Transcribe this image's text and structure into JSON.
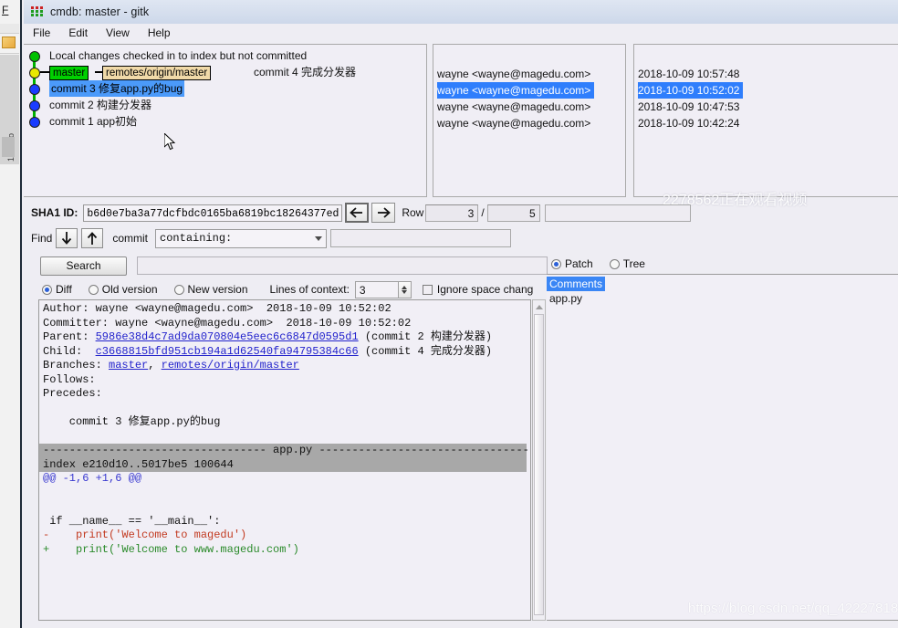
{
  "background_window": {
    "menu_fragment": "F",
    "side_label": "1. Perio"
  },
  "window": {
    "title": "cmdb: master - gitk",
    "icon": "gitk-dots-icon",
    "menus": [
      {
        "label": "File"
      },
      {
        "label": "Edit"
      },
      {
        "label": "View"
      },
      {
        "label": "Help"
      }
    ]
  },
  "commit_graph": {
    "rows": [
      {
        "node_color": "green",
        "text": "Local changes checked in to index but not committed",
        "selected": false,
        "refs": []
      },
      {
        "node_color": "yellow",
        "text": "commit 4 完成分发器",
        "selected": false,
        "refs": [
          {
            "label": "master",
            "type": "local"
          },
          {
            "label": "remotes/origin/master",
            "type": "remote"
          }
        ]
      },
      {
        "node_color": "blue",
        "text": "commit 3 修复app.py的bug",
        "selected": true,
        "refs": []
      },
      {
        "node_color": "blue",
        "text": "commit 2 构建分发器",
        "selected": false,
        "refs": []
      },
      {
        "node_color": "blue",
        "text": "commit 1 app初始",
        "selected": false,
        "refs": []
      }
    ],
    "authors": [
      {
        "value": "wayne <wayne@magedu.com>",
        "selected": false
      },
      {
        "value": "wayne <wayne@magedu.com>",
        "selected": true
      },
      {
        "value": "wayne <wayne@magedu.com>",
        "selected": false
      },
      {
        "value": "wayne <wayne@magedu.com>",
        "selected": false
      }
    ],
    "dates": [
      {
        "value": "2018-10-09 10:57:48",
        "selected": false
      },
      {
        "value": "2018-10-09 10:52:02",
        "selected": true
      },
      {
        "value": "2018-10-09 10:47:53",
        "selected": false
      },
      {
        "value": "2018-10-09 10:42:24",
        "selected": false
      }
    ]
  },
  "sha_row": {
    "label": "SHA1 ID:",
    "value": "b6d0e7ba3a77dcfbdc0165ba6819bc18264377ed",
    "back_icon": "arrow-left-icon",
    "forward_icon": "arrow-right-icon",
    "row_label": "Row",
    "row_current": "3",
    "separator": "/",
    "row_total": "5"
  },
  "find_row": {
    "label": "Find",
    "down_icon": "arrow-down-icon",
    "up_icon": "arrow-up-icon",
    "scope_label": "commit",
    "criteria": "containing:",
    "criteria_caret": "chevron-down-icon",
    "query": ""
  },
  "search_row": {
    "button_label": "Search",
    "query": ""
  },
  "diff_options": {
    "modes": [
      {
        "label": "Diff",
        "selected": true
      },
      {
        "label": "Old version",
        "selected": false
      },
      {
        "label": "New version",
        "selected": false
      }
    ],
    "context_label": "Lines of context:",
    "context_value": "3",
    "ignore_space_label": "Ignore space chang",
    "ignore_space_checked": false
  },
  "diff_panel": {
    "header_lines": [
      {
        "prefix": "Author: ",
        "text": "wayne <wayne@magedu.com>  2018-10-09 10:52:02"
      },
      {
        "prefix": "Committer: ",
        "text": "wayne <wayne@magedu.com>  2018-10-09 10:52:02"
      }
    ],
    "parent_label": "Parent: ",
    "parent_sha": "5986e38d4c7ad9da070804e5eec6c6847d0595d1",
    "parent_suffix": " (commit 2 构建分发器)",
    "child_label": "Child:  ",
    "child_sha": "c3668815bfd951cb194a1d62540fa94795384c66",
    "child_suffix": " (commit 4 完成分发器)",
    "branches_label": "Branches: ",
    "branches": [
      "master",
      "remotes/origin/master"
    ],
    "branches_separator": ", ",
    "follows_label": "Follows:",
    "precedes_label": "Precedes:",
    "commit_message": "    commit 3 修复app.py的bug",
    "file_band": "---------------------------------- app.py --------------------------------------",
    "index_line": "index e210d10..5017be5 100644",
    "hunk_line": "@@ -1,6 +1,6 @@",
    "diff_lines": [
      {
        "type": "context",
        "text": " if __name__ == '__main__':"
      },
      {
        "type": "removed",
        "text": "-    print('Welcome to magedu')"
      },
      {
        "type": "added",
        "text": "+    print('Welcome to www.magedu.com')"
      }
    ]
  },
  "right_panel": {
    "view_modes": [
      {
        "label": "Patch",
        "selected": true
      },
      {
        "label": "Tree",
        "selected": false
      }
    ],
    "files": [
      {
        "name": "Comments",
        "selected": true
      },
      {
        "name": "app.py",
        "selected": false
      }
    ]
  },
  "watermarks": {
    "viewer_note": "2278562正在观看视频",
    "blog_url": "https://blog.csdn.net/qq_42227818"
  }
}
